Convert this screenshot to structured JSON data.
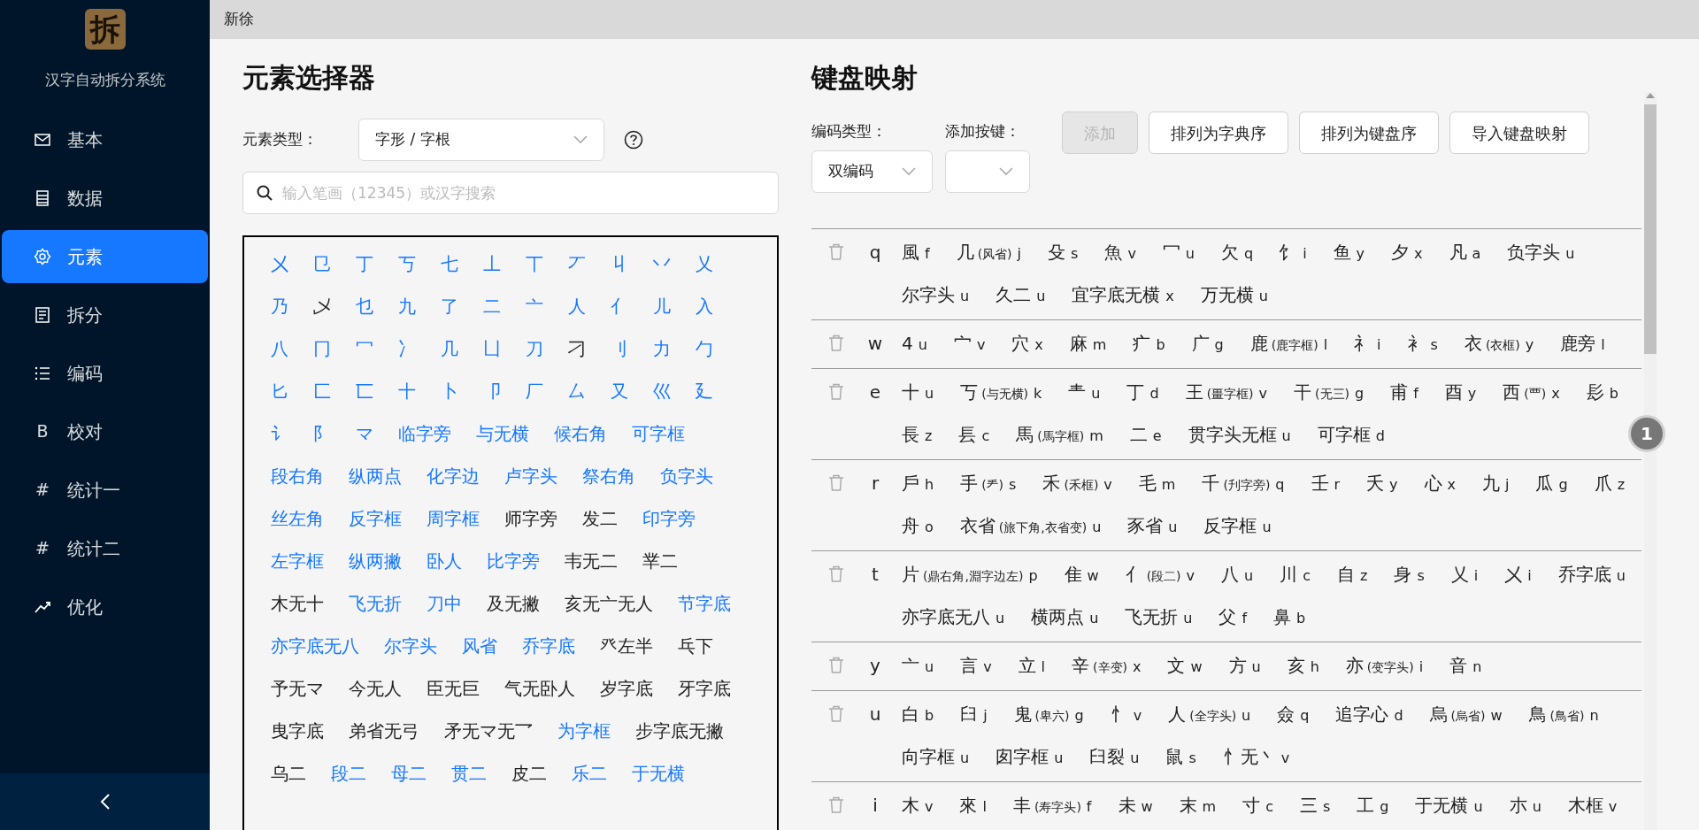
{
  "sidebar": {
    "logo_text": "拆",
    "title": "汉字自动拆分系统",
    "items": [
      {
        "label": "基本",
        "selected": false
      },
      {
        "label": "数据",
        "selected": false
      },
      {
        "label": "元素",
        "selected": true
      },
      {
        "label": "拆分",
        "selected": false
      },
      {
        "label": "编码",
        "selected": false
      },
      {
        "label": "校对",
        "glyph": "B",
        "selected": false
      },
      {
        "label": "统计一",
        "glyph": "#",
        "selected": false
      },
      {
        "label": "统计二",
        "glyph": "#",
        "selected": false
      },
      {
        "label": "优化",
        "selected": false
      }
    ]
  },
  "top_bar": {
    "title": "新徐"
  },
  "element_selector": {
    "title": "元素选择器",
    "type_label": "元素类型：",
    "type_value": "字形 / 字根",
    "search_placeholder": "输入笔画（12345）或汉字搜索",
    "elements": [
      {
        "text": "㐅",
        "assigned": true
      },
      {
        "text": "㔾",
        "assigned": true
      },
      {
        "text": "丁",
        "assigned": true
      },
      {
        "text": "丂",
        "assigned": true
      },
      {
        "text": "七",
        "assigned": true
      },
      {
        "text": "丄",
        "assigned": true
      },
      {
        "text": "丅",
        "assigned": true
      },
      {
        "text": "丆",
        "assigned": true
      },
      {
        "text": "丩",
        "assigned": true
      },
      {
        "text": "丷",
        "assigned": true
      },
      {
        "text": "乂",
        "assigned": true
      },
      {
        "text": "乃",
        "assigned": true
      },
      {
        "text": "乄",
        "assigned": false
      },
      {
        "text": "乜",
        "assigned": true
      },
      {
        "text": "九",
        "assigned": true
      },
      {
        "text": "了",
        "assigned": true
      },
      {
        "text": "二",
        "assigned": true
      },
      {
        "text": "亠",
        "assigned": true
      },
      {
        "text": "人",
        "assigned": true
      },
      {
        "text": "亻",
        "assigned": true
      },
      {
        "text": "儿",
        "assigned": true
      },
      {
        "text": "入",
        "assigned": true
      },
      {
        "text": "八",
        "assigned": true
      },
      {
        "text": "冂",
        "assigned": true
      },
      {
        "text": "冖",
        "assigned": true
      },
      {
        "text": "冫",
        "assigned": true
      },
      {
        "text": "几",
        "assigned": true
      },
      {
        "text": "凵",
        "assigned": true
      },
      {
        "text": "刀",
        "assigned": true
      },
      {
        "text": "刁",
        "assigned": false
      },
      {
        "text": "刂",
        "assigned": true
      },
      {
        "text": "力",
        "assigned": true
      },
      {
        "text": "勹",
        "assigned": true
      },
      {
        "text": "匕",
        "assigned": true
      },
      {
        "text": "匚",
        "assigned": true
      },
      {
        "text": "匸",
        "assigned": true
      },
      {
        "text": "十",
        "assigned": true
      },
      {
        "text": "卜",
        "assigned": true
      },
      {
        "text": "卩",
        "assigned": true
      },
      {
        "text": "厂",
        "assigned": true
      },
      {
        "text": "厶",
        "assigned": true
      },
      {
        "text": "又",
        "assigned": true
      },
      {
        "text": "巛",
        "assigned": true
      },
      {
        "text": "廴",
        "assigned": true
      },
      {
        "text": "讠",
        "assigned": true
      },
      {
        "text": "阝",
        "assigned": true
      },
      {
        "text": "マ",
        "assigned": true
      },
      {
        "text": "临字旁",
        "assigned": true
      },
      {
        "text": "与无横",
        "assigned": true
      },
      {
        "text": "候右角",
        "assigned": true
      },
      {
        "text": "可字框",
        "assigned": true
      },
      {
        "text": "段右角",
        "assigned": true
      },
      {
        "text": "纵两点",
        "assigned": true
      },
      {
        "text": "化字边",
        "assigned": true
      },
      {
        "text": "卢字头",
        "assigned": true
      },
      {
        "text": "祭右角",
        "assigned": true
      },
      {
        "text": "负字头",
        "assigned": true
      },
      {
        "text": "丝左角",
        "assigned": true
      },
      {
        "text": "反字框",
        "assigned": true
      },
      {
        "text": "周字框",
        "assigned": true
      },
      {
        "text": "师字旁",
        "assigned": false
      },
      {
        "text": "发二",
        "assigned": false
      },
      {
        "text": "印字旁",
        "assigned": true
      },
      {
        "text": "左字框",
        "assigned": true
      },
      {
        "text": "纵两撇",
        "assigned": true
      },
      {
        "text": "卧人",
        "assigned": true
      },
      {
        "text": "比字旁",
        "assigned": true
      },
      {
        "text": "韦无二",
        "assigned": false
      },
      {
        "text": "丵二",
        "assigned": false
      },
      {
        "text": "木无十",
        "assigned": false
      },
      {
        "text": "飞无折",
        "assigned": true
      },
      {
        "text": "刀中",
        "assigned": true
      },
      {
        "text": "及无撇",
        "assigned": false
      },
      {
        "text": "亥无亠无人",
        "assigned": false
      },
      {
        "text": "节字底",
        "assigned": true
      },
      {
        "text": "亦字底无八",
        "assigned": true
      },
      {
        "text": "尔字头",
        "assigned": true
      },
      {
        "text": "风省",
        "assigned": true
      },
      {
        "text": "乔字底",
        "assigned": true
      },
      {
        "text": "癶左半",
        "assigned": false
      },
      {
        "text": "乓下",
        "assigned": false
      },
      {
        "text": "予无マ",
        "assigned": false
      },
      {
        "text": "今无人",
        "assigned": false
      },
      {
        "text": "臣无巨",
        "assigned": false
      },
      {
        "text": "气无卧人",
        "assigned": false
      },
      {
        "text": "岁字底",
        "assigned": false
      },
      {
        "text": "牙字底",
        "assigned": false
      },
      {
        "text": "曳字底",
        "assigned": false
      },
      {
        "text": "弟省无弓",
        "assigned": false
      },
      {
        "text": "矛无マ无乛",
        "assigned": false
      },
      {
        "text": "为字框",
        "assigned": true
      },
      {
        "text": "步字底无撇",
        "assigned": false
      },
      {
        "text": "乌二",
        "assigned": false
      },
      {
        "text": "段二",
        "assigned": true
      },
      {
        "text": "母二",
        "assigned": true
      },
      {
        "text": "贯二",
        "assigned": true
      },
      {
        "text": "皮二",
        "assigned": false
      },
      {
        "text": "乐二",
        "assigned": true
      },
      {
        "text": "于无横",
        "assigned": true
      }
    ]
  },
  "keyboard_mapping": {
    "title": "键盘映射",
    "encoding_label": "编码类型：",
    "encoding_value": "双编码",
    "add_key_label": "添加按键：",
    "buttons": [
      {
        "label": "添加",
        "disabled": true
      },
      {
        "label": "排列为字典序",
        "disabled": false
      },
      {
        "label": "排列为键盘序",
        "disabled": false
      },
      {
        "label": "导入键盘映射",
        "disabled": false
      }
    ],
    "badge": "1",
    "rows": [
      {
        "key": "q",
        "entries": [
          {
            "text": "風",
            "code": "f"
          },
          {
            "text": "几",
            "note": "(风省)",
            "code": "j"
          },
          {
            "text": "殳",
            "code": "s"
          },
          {
            "text": "魚",
            "code": "v"
          },
          {
            "text": "冖",
            "code": "u"
          },
          {
            "text": "欠",
            "code": "q"
          },
          {
            "text": "饣",
            "code": "i"
          },
          {
            "text": "鱼",
            "code": "y"
          },
          {
            "text": "夕",
            "code": "x"
          },
          {
            "text": "凡",
            "code": "a"
          },
          {
            "text": "负字头",
            "code": "u"
          },
          {
            "text": "尔字头",
            "code": "u"
          },
          {
            "text": "久二",
            "code": "u"
          },
          {
            "text": "宜字底无横",
            "code": "x"
          },
          {
            "text": "万无横",
            "code": "u"
          }
        ]
      },
      {
        "key": "w",
        "entries": [
          {
            "text": "4",
            "code": "u"
          },
          {
            "text": "宀",
            "code": "v"
          },
          {
            "text": "穴",
            "code": "x"
          },
          {
            "text": "麻",
            "code": "m"
          },
          {
            "text": "疒",
            "code": "b"
          },
          {
            "text": "广",
            "code": "g"
          },
          {
            "text": "鹿",
            "note": "(鹿字框)",
            "code": "l"
          },
          {
            "text": "礻",
            "code": "i"
          },
          {
            "text": "衤",
            "code": "s"
          },
          {
            "text": "衣",
            "note": "(衣框)",
            "code": "y"
          },
          {
            "text": "鹿旁",
            "code": "l"
          }
        ]
      },
      {
        "key": "e",
        "entries": [
          {
            "text": "十",
            "code": "u"
          },
          {
            "text": "丂",
            "note": "(与无横)",
            "code": "k"
          },
          {
            "text": "龶",
            "code": "u"
          },
          {
            "text": "丁",
            "code": "d"
          },
          {
            "text": "王",
            "note": "(畺字框)",
            "code": "v"
          },
          {
            "text": "干",
            "note": "(无三)",
            "code": "g"
          },
          {
            "text": "甫",
            "code": "f"
          },
          {
            "text": "酉",
            "code": "y"
          },
          {
            "text": "西",
            "note": "(覀)",
            "code": "x"
          },
          {
            "text": "髟",
            "code": "b"
          },
          {
            "text": "長",
            "code": "z"
          },
          {
            "text": "镸",
            "code": "c"
          },
          {
            "text": "馬",
            "note": "(馬字框)",
            "code": "m"
          },
          {
            "text": "二",
            "code": "e"
          },
          {
            "text": "贯字头无框",
            "code": "u"
          },
          {
            "text": "可字框",
            "code": "d"
          }
        ]
      },
      {
        "key": "r",
        "entries": [
          {
            "text": "戶",
            "code": "h"
          },
          {
            "text": "手",
            "note": "(龵)",
            "code": "s"
          },
          {
            "text": "禾",
            "note": "(禾框)",
            "code": "v"
          },
          {
            "text": "毛",
            "code": "m"
          },
          {
            "text": "千",
            "note": "(刋字旁)",
            "code": "q"
          },
          {
            "text": "壬",
            "code": "r"
          },
          {
            "text": "夭",
            "code": "y"
          },
          {
            "text": "心",
            "code": "x"
          },
          {
            "text": "九",
            "code": "j"
          },
          {
            "text": "瓜",
            "code": "g"
          },
          {
            "text": "爪",
            "code": "z"
          },
          {
            "text": "舟",
            "code": "o"
          },
          {
            "text": "衣省",
            "note": "(旅下角,衣省变)",
            "code": "u"
          },
          {
            "text": "豕省",
            "code": "u"
          },
          {
            "text": "反字框",
            "code": "u"
          }
        ]
      },
      {
        "key": "t",
        "entries": [
          {
            "text": "片",
            "note": "(鼎右角,淵字边左)",
            "code": "p"
          },
          {
            "text": "隹",
            "code": "w"
          },
          {
            "text": "亻",
            "note": "(段二)",
            "code": "v"
          },
          {
            "text": "八",
            "code": "u"
          },
          {
            "text": "川",
            "code": "c"
          },
          {
            "text": "自",
            "code": "z"
          },
          {
            "text": "身",
            "code": "s"
          },
          {
            "text": "乂",
            "code": "i"
          },
          {
            "text": "㐅",
            "code": "i"
          },
          {
            "text": "乔字底",
            "code": "u"
          },
          {
            "text": "亦字底无八",
            "code": "u"
          },
          {
            "text": "横两点",
            "code": "u"
          },
          {
            "text": "飞无折",
            "code": "u"
          },
          {
            "text": "父",
            "code": "f"
          },
          {
            "text": "鼻",
            "code": "b"
          }
        ]
      },
      {
        "key": "y",
        "entries": [
          {
            "text": "亠",
            "code": "u"
          },
          {
            "text": "言",
            "code": "v"
          },
          {
            "text": "立",
            "code": "l"
          },
          {
            "text": "辛",
            "note": "(辛变)",
            "code": "x"
          },
          {
            "text": "文",
            "code": "w"
          },
          {
            "text": "方",
            "code": "u"
          },
          {
            "text": "亥",
            "code": "h"
          },
          {
            "text": "亦",
            "note": "(变字头)",
            "code": "i"
          },
          {
            "text": "音",
            "code": "n"
          }
        ]
      },
      {
        "key": "u",
        "entries": [
          {
            "text": "白",
            "code": "b"
          },
          {
            "text": "臼",
            "code": "j"
          },
          {
            "text": "鬼",
            "note": "(卑六)",
            "code": "g"
          },
          {
            "text": "忄",
            "code": "v"
          },
          {
            "text": "人",
            "note": "(全字头)",
            "code": "u"
          },
          {
            "text": "僉",
            "code": "q"
          },
          {
            "text": "追字心",
            "code": "d"
          },
          {
            "text": "烏",
            "note": "(烏省)",
            "code": "w"
          },
          {
            "text": "鳥",
            "note": "(鳥省)",
            "code": "n"
          },
          {
            "text": "向字框",
            "code": "u"
          },
          {
            "text": "囱字框",
            "code": "u"
          },
          {
            "text": "臼裂",
            "code": "u"
          },
          {
            "text": "鼠",
            "code": "s"
          },
          {
            "text": "忄无丶",
            "code": "v"
          }
        ]
      },
      {
        "key": "i",
        "entries": [
          {
            "text": "木",
            "code": "v"
          },
          {
            "text": "來",
            "code": "l"
          },
          {
            "text": "丰",
            "note": "(寿字头)",
            "code": "f"
          },
          {
            "text": "未",
            "code": "w"
          },
          {
            "text": "末",
            "code": "m"
          },
          {
            "text": "寸",
            "code": "c"
          },
          {
            "text": "三",
            "code": "s"
          },
          {
            "text": "工",
            "code": "g"
          },
          {
            "text": "于无横",
            "code": "u"
          },
          {
            "text": "朩",
            "code": "u"
          },
          {
            "text": "木框",
            "code": "v"
          }
        ]
      }
    ]
  }
}
